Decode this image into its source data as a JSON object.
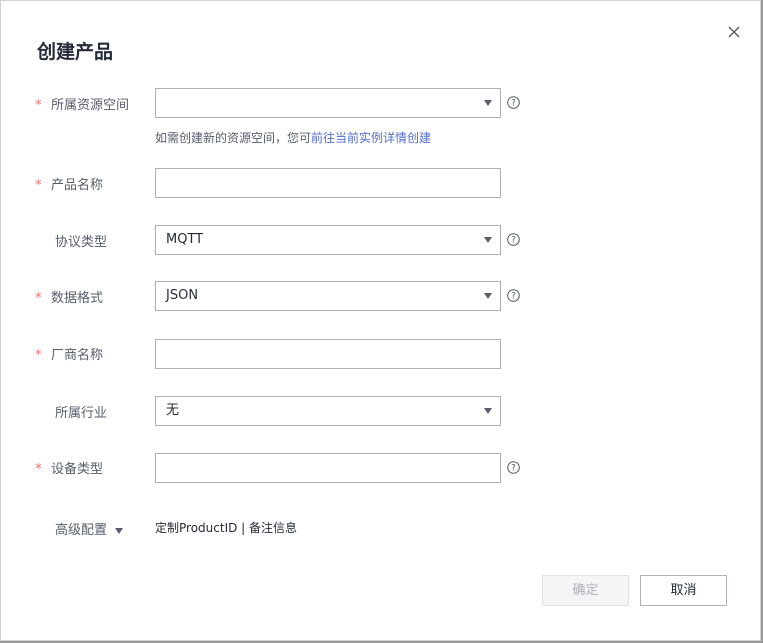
{
  "dialog": {
    "title": "创建产品",
    "close_icon": "close-icon",
    "hint_text": "如需创建新的资源空间，您可",
    "hint_link": "前往当前实例详情创建",
    "fields": {
      "resource_space": {
        "label": "所属资源空间",
        "required": true,
        "value": ""
      },
      "product_name": {
        "label": "产品名称",
        "required": true,
        "value": ""
      },
      "protocol": {
        "label": "协议类型",
        "required": false,
        "value": "MQTT"
      },
      "data_format": {
        "label": "数据格式",
        "required": true,
        "value": "JSON"
      },
      "vendor_name": {
        "label": "厂商名称",
        "required": true,
        "value": ""
      },
      "industry": {
        "label": "所属行业",
        "required": false,
        "value": "无"
      },
      "device_type": {
        "label": "设备类型",
        "required": true,
        "value": ""
      }
    },
    "required_mark": "*",
    "advanced": {
      "label": "高级配置",
      "links": "定制ProductID | 备注信息"
    },
    "buttons": {
      "ok": "确定",
      "cancel": "取消"
    },
    "colors": {
      "required": "#f66f6a",
      "link": "#526ecc",
      "border": "#adb0b8"
    }
  }
}
